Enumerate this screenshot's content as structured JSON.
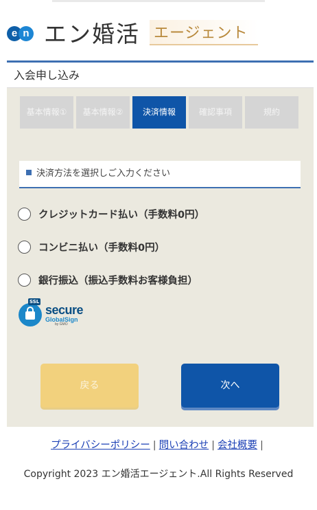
{
  "header": {
    "logo_mark": [
      "e",
      "n"
    ],
    "brand_name": "エン婚活",
    "brand_sub": "エージェント"
  },
  "panel": {
    "title": "入会申し込み"
  },
  "steps": [
    {
      "label": "基本情報①",
      "active": false
    },
    {
      "label": "基本情報②",
      "active": false
    },
    {
      "label": "決済情報",
      "active": true
    },
    {
      "label": "確認事項",
      "active": false
    },
    {
      "label": "規約",
      "active": false
    }
  ],
  "payment": {
    "section_label": "決済方法を選択しご入力ください",
    "options": [
      {
        "label": "クレジットカード払い（手数料0円）",
        "selected": false
      },
      {
        "label": "コンビニ払い（手数料0円）",
        "selected": false
      },
      {
        "label": "銀行振込（振込手数料お客様負担）",
        "selected": false
      }
    ]
  },
  "ssl_seal": {
    "tag": "SSL",
    "secure": "secure",
    "globalsign": "GlobalSign",
    "gmo": "by GMO"
  },
  "buttons": {
    "back": "戻る",
    "next": "次へ"
  },
  "footer": {
    "links": [
      "プライバシーポリシー",
      "問い合わせ",
      "会社概要"
    ],
    "separator": "|",
    "copyright": "Copyright 2023 エン婚活エージェント.All Rights Reserved"
  },
  "colors": {
    "primary": "#0f55a8",
    "accent_border": "#3d6fb2",
    "panel_bg": "#ebe9df",
    "back_button": "#f2d17d",
    "step_inactive": "#d5d5d5",
    "link": "#1a3fb5",
    "brand_sub": "#b8893b"
  }
}
